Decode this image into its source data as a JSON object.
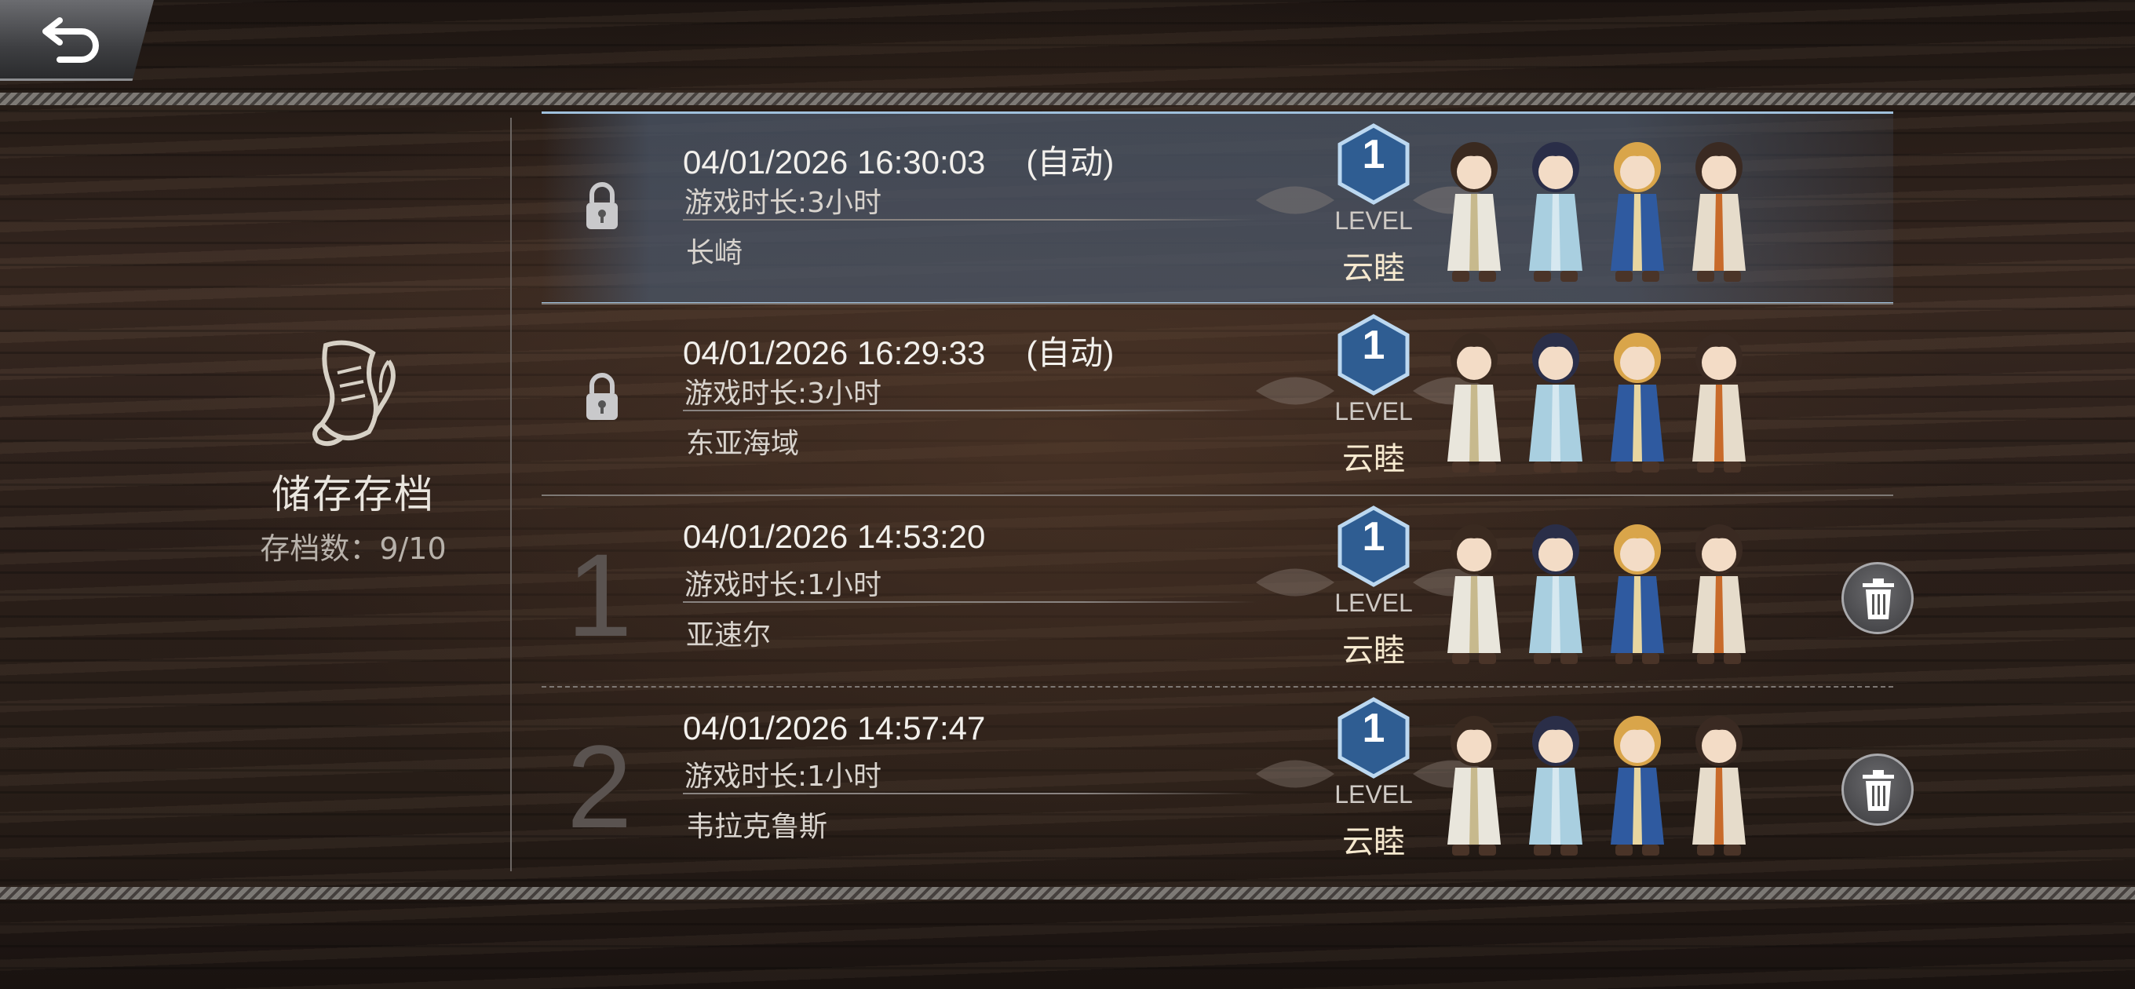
{
  "header": {
    "back_icon": "back-arrow-icon"
  },
  "left_panel": {
    "icon": "scroll-quill-icon",
    "title": "储存存档",
    "count": "存档数：9/10"
  },
  "saves": [
    {
      "slot": "",
      "locked": true,
      "date": "04/01/2026 16:30:03",
      "auto": "(自动)",
      "playtime": "游戏时长:3小时",
      "location": "长崎",
      "level": "1",
      "level_label": "LEVEL",
      "party_leader": "云睦",
      "deletable": false,
      "selected": true
    },
    {
      "slot": "",
      "locked": true,
      "date": "04/01/2026 16:29:33",
      "auto": "(自动)",
      "playtime": "游戏时长:3小时",
      "location": "东亚海域",
      "level": "1",
      "level_label": "LEVEL",
      "party_leader": "云睦",
      "deletable": false,
      "selected": false
    },
    {
      "slot": "1",
      "locked": false,
      "date": "04/01/2026 14:53:20",
      "auto": "",
      "playtime": "游戏时长:1小时",
      "location": "亚速尔",
      "level": "1",
      "level_label": "LEVEL",
      "party_leader": "云睦",
      "deletable": true,
      "selected": false
    },
    {
      "slot": "2",
      "locked": false,
      "date": "04/01/2026 14:57:47",
      "auto": "",
      "playtime": "游戏时长:1小时",
      "location": "韦拉克鲁斯",
      "level": "1",
      "level_label": "LEVEL",
      "party_leader": "云睦",
      "deletable": true,
      "selected": false
    }
  ],
  "colors": {
    "highlight_border": "#9fc0dc",
    "level_hex": "#2f5d92",
    "level_hex_border": "#bcd8f0"
  }
}
